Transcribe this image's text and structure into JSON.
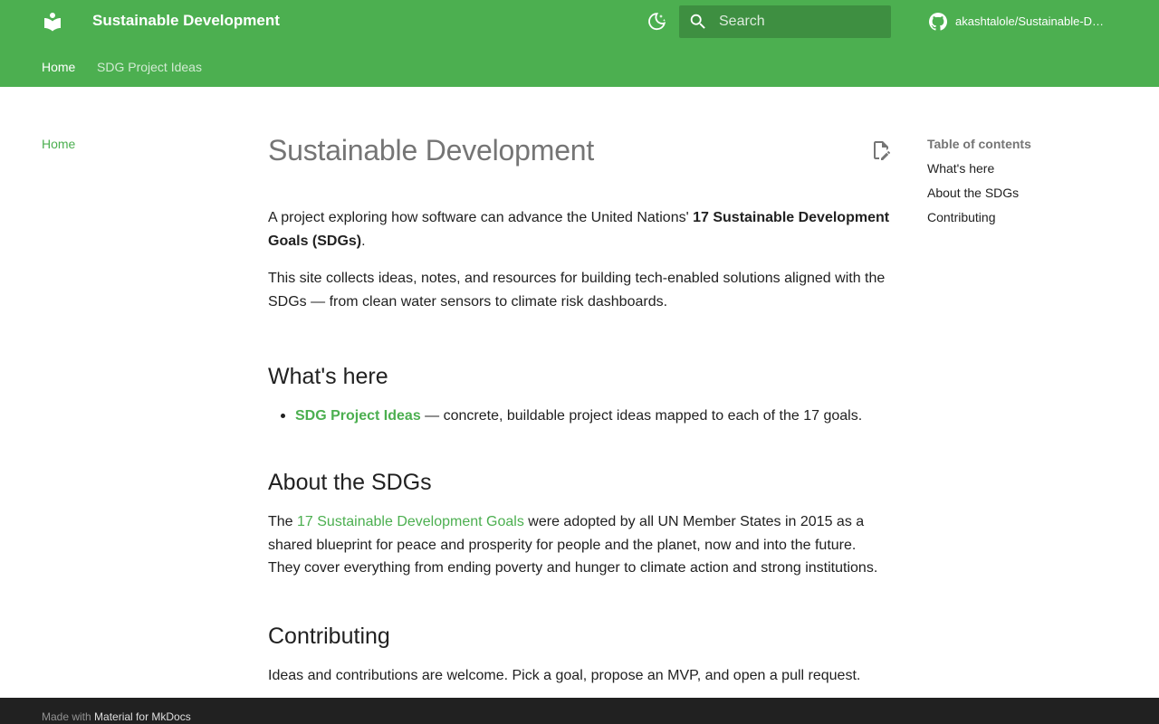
{
  "header": {
    "title": "Sustainable Development",
    "search_placeholder": "Search",
    "repo_name": "akashtalole/Sustainable-De…",
    "accent_color": "#4caf50",
    "icons": {
      "logo": "book-icon",
      "theme": "moon-icon",
      "search": "search-icon",
      "repo": "github-icon"
    }
  },
  "tabs": [
    {
      "label": "Home",
      "active": true
    },
    {
      "label": "SDG Project Ideas",
      "active": false
    }
  ],
  "sidebar": {
    "items": [
      {
        "label": "Home",
        "active": true
      }
    ]
  },
  "content": {
    "title": "Sustainable Development",
    "intro": {
      "text_before": "A project exploring how software can advance the United Nations' ",
      "bold": "17 Sustainable Development Goals (SDGs)",
      "text_after": "."
    },
    "intro2": "This site collects ideas, notes, and resources for building tech-enabled solutions aligned with the SDGs — from clean water sensors to climate risk dashboards.",
    "whats_here": {
      "heading": "What's here",
      "items": [
        {
          "link": "SDG Project Ideas",
          "text": " — concrete, buildable project ideas mapped to each of the 17 goals."
        }
      ]
    },
    "about": {
      "heading": "About the SDGs",
      "text_before": "The ",
      "link": "17 Sustainable Development Goals",
      "text_after": " were adopted by all UN Member States in 2015 as a shared blueprint for peace and prosperity for people and the planet, now and into the future. They cover everything from ending poverty and hunger to climate action and strong institutions."
    },
    "contributing": {
      "heading": "Contributing",
      "text": "Ideas and contributions are welcome. Pick a goal, propose an MVP, and open a pull request."
    }
  },
  "toc": {
    "title": "Table of contents",
    "items": [
      "What's here",
      "About the SDGs",
      "Contributing"
    ]
  },
  "footer": {
    "prefix": "Made with",
    "link": "Material for MkDocs"
  }
}
